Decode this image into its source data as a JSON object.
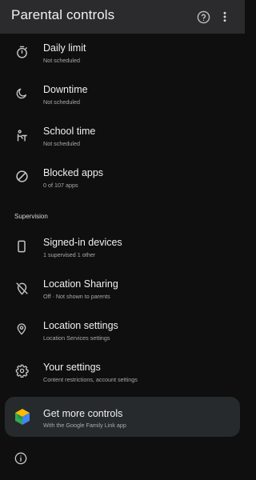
{
  "appbar": {
    "title": "Parental controls",
    "help_icon": "help-circle-icon",
    "more_icon": "more-vert-icon"
  },
  "items": [
    {
      "title": "Daily limit",
      "subtitle": "Not scheduled",
      "icon": "timer-icon"
    },
    {
      "title": "Downtime",
      "subtitle": "Not scheduled",
      "icon": "moon-icon"
    },
    {
      "title": "School time",
      "subtitle": "Not scheduled",
      "icon": "school-desk-icon"
    },
    {
      "title": "Blocked apps",
      "subtitle": "0 of 107 apps",
      "icon": "block-icon"
    }
  ],
  "supervision": {
    "label": "Supervision",
    "items": [
      {
        "title": "Signed-in devices",
        "subtitle": "1 supervised 1 other",
        "icon": "phone-icon"
      },
      {
        "title": "Location Sharing",
        "subtitle": "Off · Not shown to parents",
        "icon": "location-off-icon"
      },
      {
        "title": "Location settings",
        "subtitle": "Location Services settings",
        "icon": "location-pin-icon"
      },
      {
        "title": "Your settings",
        "subtitle": "Content restrictions, account settings",
        "icon": "gear-icon"
      }
    ]
  },
  "promo": {
    "title": "Get more controls",
    "subtitle": "With the Google Family Link app",
    "icon": "family-link-icon"
  },
  "footer": {
    "icon": "info-icon"
  },
  "colors": {
    "background": "#0f0f0f",
    "appbar": "#2b2b2d",
    "card": "#262a2d",
    "text": "#f0f0f0",
    "subtext": "#a9a9a9"
  }
}
